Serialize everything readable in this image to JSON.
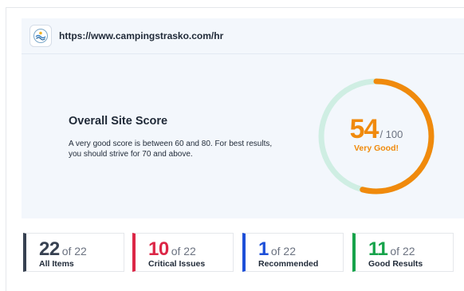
{
  "site": {
    "url": "https://www.campingstrasko.com/hr",
    "favicon_icon": "camping-logo-icon"
  },
  "score": {
    "title": "Overall Site Score",
    "description": "A very good score is between 60 and 80. For best results, you should strive for 70 and above.",
    "value": "54",
    "max": "/ 100",
    "rating": "Very Good!",
    "fraction": 0.54,
    "accent_color": "#f08a0c",
    "track_color": "#cfeee3"
  },
  "stats": [
    {
      "value": "22",
      "of": "of 22",
      "label": "All Items",
      "color": "#374151"
    },
    {
      "value": "10",
      "of": "of 22",
      "label": "Critical Issues",
      "color": "#dc2646"
    },
    {
      "value": "1",
      "of": "of 22",
      "label": "Recommended",
      "color": "#1d4fd8"
    },
    {
      "value": "11",
      "of": "of 22",
      "label": "Good Results",
      "color": "#16a34a"
    }
  ]
}
